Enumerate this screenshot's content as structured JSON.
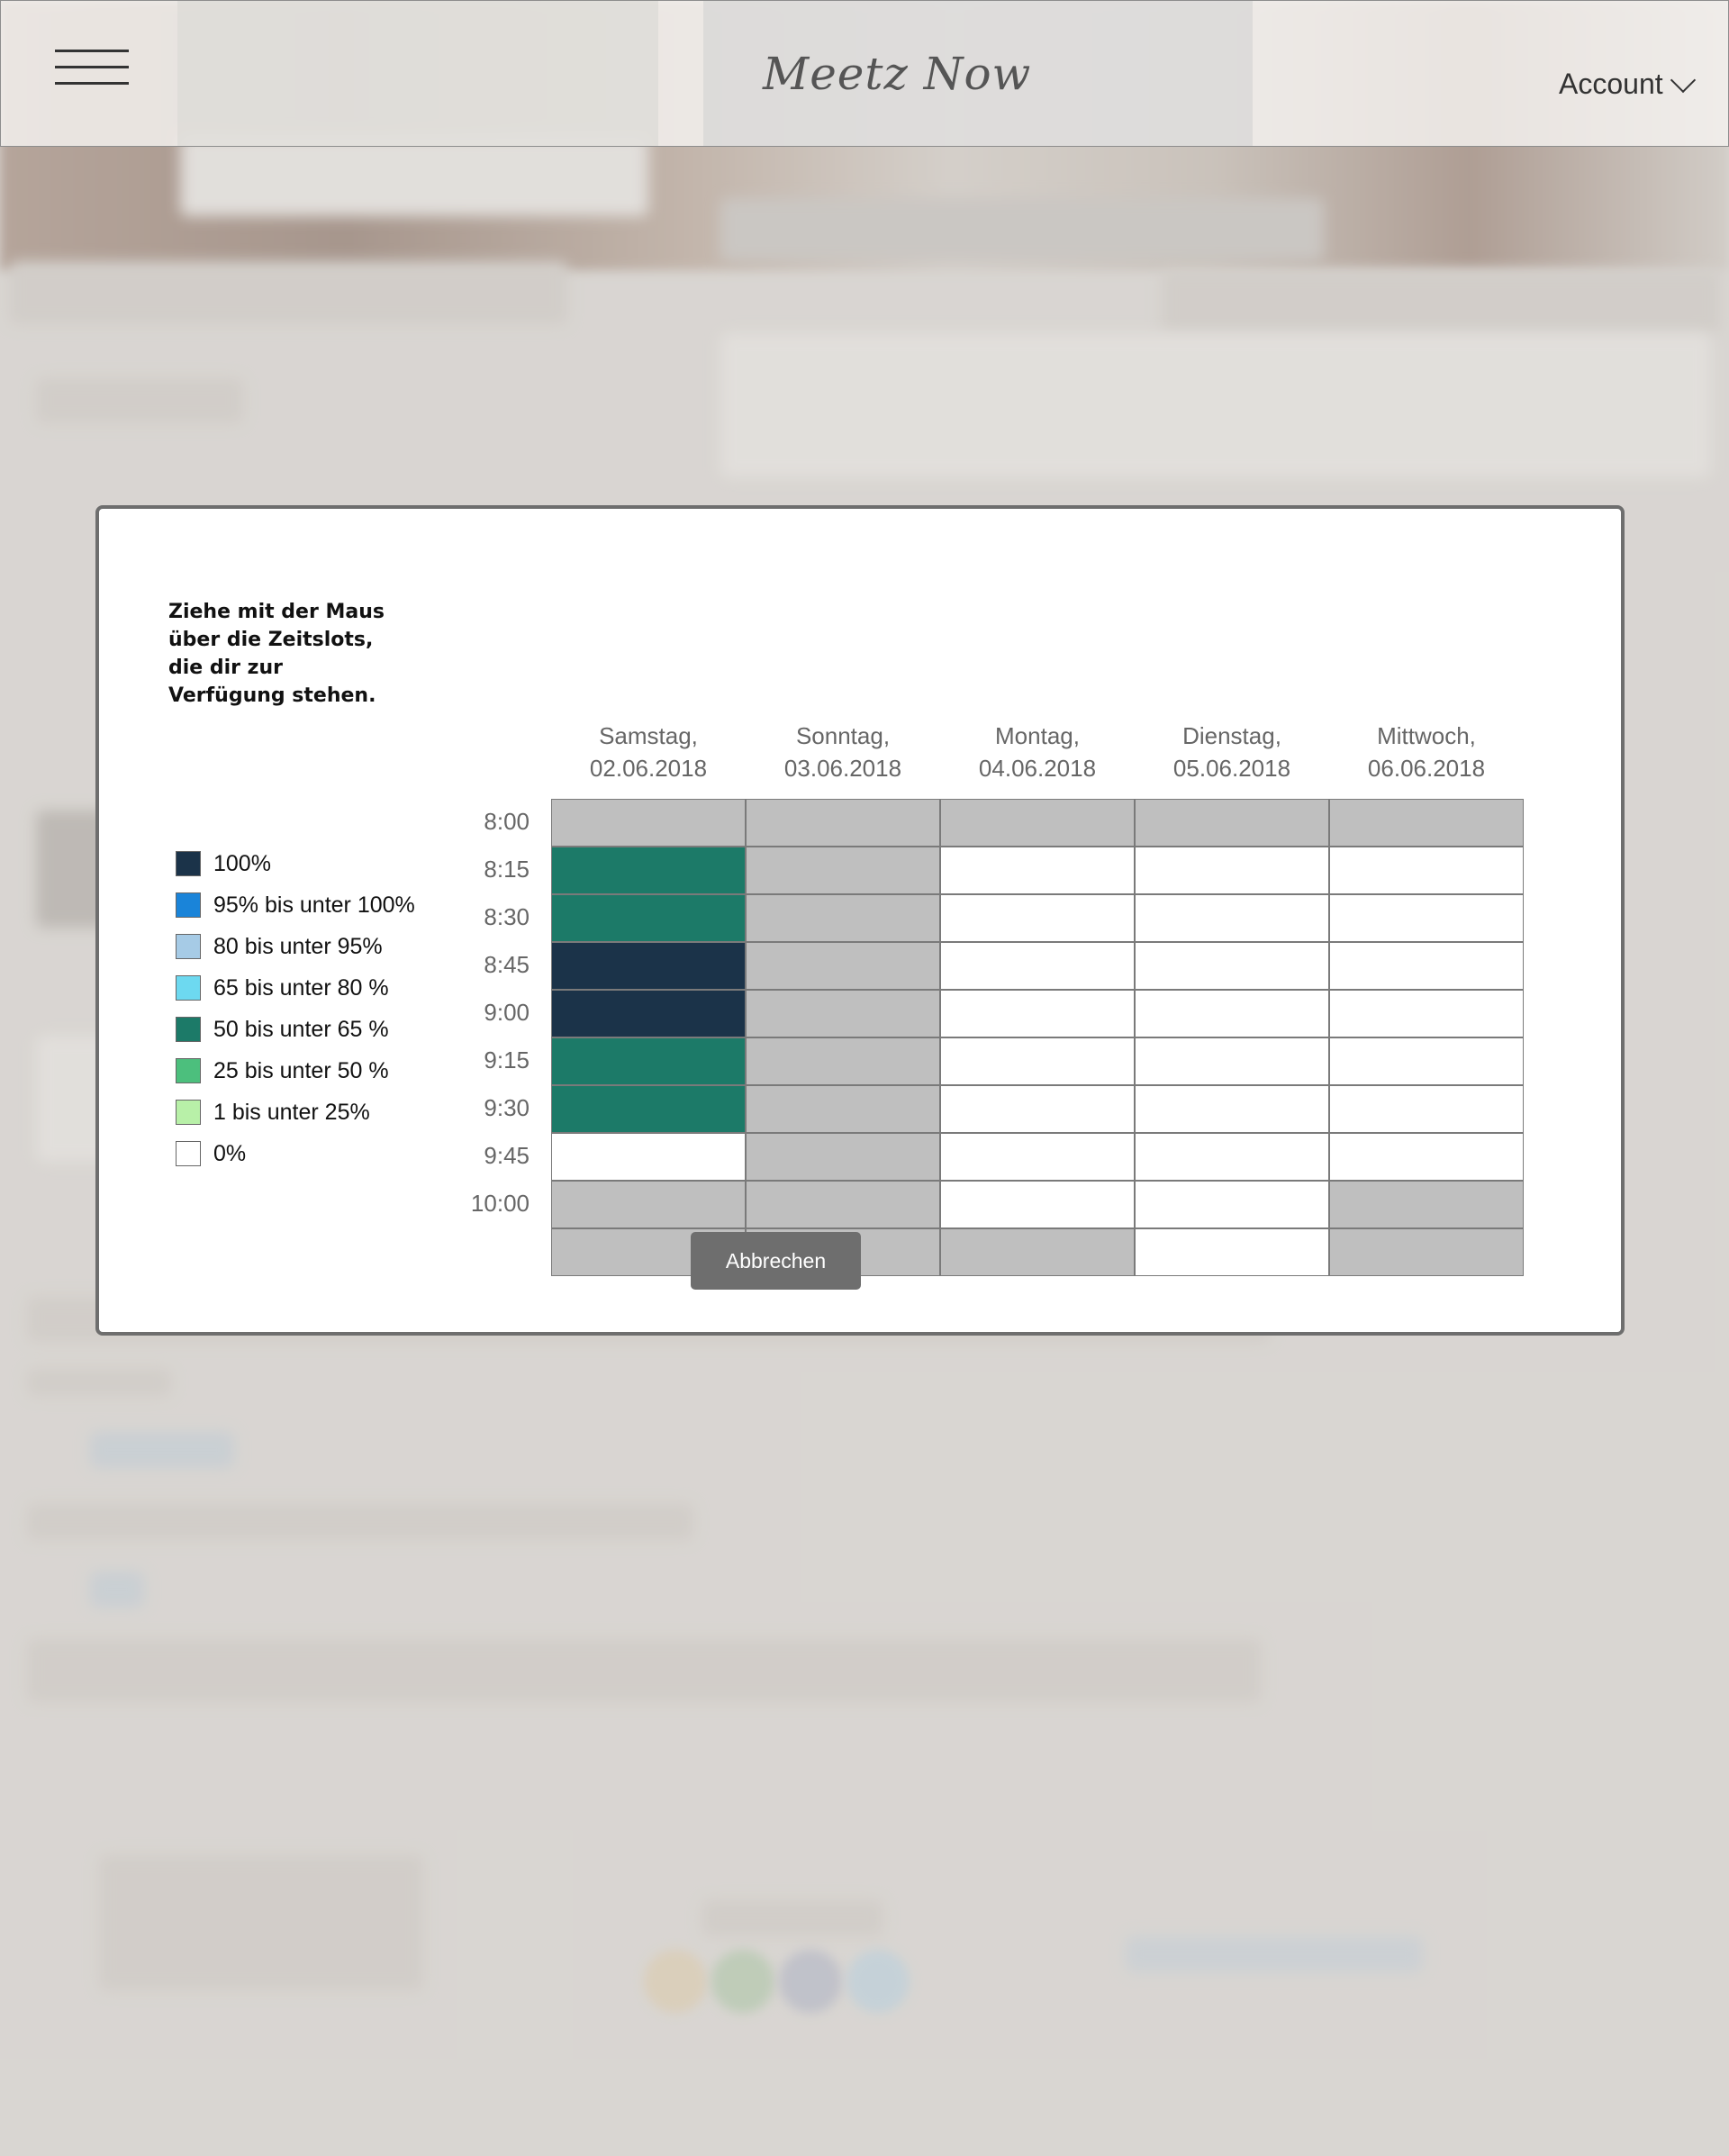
{
  "header": {
    "logo": "Meetz Now",
    "account_label": "Account"
  },
  "modal": {
    "instructions": "Ziehe mit der Maus über die Zeitslots, die dir zur Verfügung stehen.",
    "cancel_label": "Abbrechen",
    "legend": [
      {
        "label": "100%",
        "color": "#1b3349"
      },
      {
        "label": "95% bis unter 100%",
        "color": "#1a84d9"
      },
      {
        "label": "80 bis unter 95%",
        "color": "#a6cbe6"
      },
      {
        "label": "65 bis unter 80 %",
        "color": "#6dd9f0"
      },
      {
        "label": "50 bis unter 65 %",
        "color": "#1c7a68"
      },
      {
        "label": "25 bis unter 50 %",
        "color": "#4cbf7d"
      },
      {
        "label": "1 bis unter 25%",
        "color": "#b8f0a8"
      },
      {
        "label": "0%",
        "color": "#ffffff"
      }
    ],
    "days": [
      {
        "weekday": "Samstag,",
        "date": "02.06.2018"
      },
      {
        "weekday": "Sonntag,",
        "date": "03.06.2018"
      },
      {
        "weekday": "Montag,",
        "date": "04.06.2018"
      },
      {
        "weekday": "Dienstag,",
        "date": "05.06.2018"
      },
      {
        "weekday": "Mittwoch,",
        "date": "06.06.2018"
      }
    ],
    "times": [
      "8:00",
      "8:15",
      "8:30",
      "8:45",
      "9:00",
      "9:15",
      "9:30",
      "9:45",
      "10:00"
    ],
    "slot_states": [
      [
        "unavailable",
        "unavailable",
        "unavailable",
        "unavailable",
        "unavailable"
      ],
      [
        "50-65",
        "unavailable",
        "0",
        "0",
        "0"
      ],
      [
        "50-65",
        "unavailable",
        "0",
        "0",
        "0"
      ],
      [
        "100",
        "unavailable",
        "0",
        "0",
        "0"
      ],
      [
        "100",
        "unavailable",
        "0",
        "0",
        "0"
      ],
      [
        "50-65",
        "unavailable",
        "0",
        "0",
        "0"
      ],
      [
        "50-65",
        "unavailable",
        "0",
        "0",
        "0"
      ],
      [
        "0",
        "unavailable",
        "0",
        "0",
        "0"
      ],
      [
        "unavailable",
        "unavailable",
        "0",
        "0",
        "unavailable"
      ],
      [
        "unavailable",
        "unavailable",
        "unavailable",
        "0",
        "unavailable"
      ]
    ],
    "state_colors": {
      "unavailable": "#bfbfbf",
      "0": "#ffffff",
      "50-65": "#1c7a68",
      "100": "#1b3349"
    }
  }
}
